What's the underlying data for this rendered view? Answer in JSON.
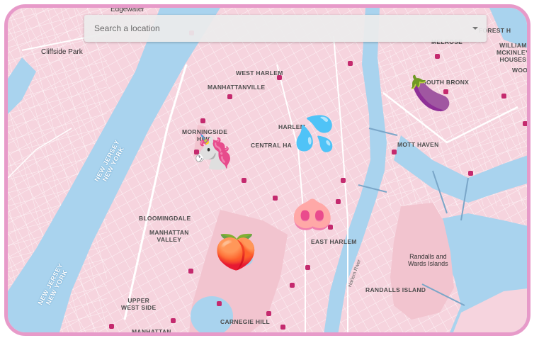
{
  "search": {
    "placeholder": "Search a location"
  },
  "colors": {
    "water": "#a9d3ee",
    "land": "#f6d4de",
    "park": "#f2c4cf",
    "frame": "#e79ac9",
    "poi": "#c42a6e"
  },
  "places": {
    "edgewater": "Edgewater",
    "forest_hills": "FOREST H",
    "cliffside_park": "Cliffside Park",
    "melrose": "MELROSE",
    "williams_mckinley": "WILLIAM\nMCKINLEY\nHOUSES",
    "woodst": "WOODST",
    "west_harlem": "WEST HARLEM",
    "manhattanville": "MANHATTANVILLE",
    "south_bronx": "SOUTH BRONX",
    "harlem": "HARLEM",
    "morningside": "MORNINGSIDE\nHEIG",
    "central_harlem": "CENTRAL HA",
    "mott_haven": "MOTT HAVEN",
    "new_jersey_top": "NEW JERSEY\nNEW YORK",
    "bloomingdale": "BLOOMINGDALE",
    "manhattan_valley": "MANHATTAN\nVALLEY",
    "east_harlem": "EAST HARLEM",
    "randalls_wards": "Randalls and\nWards Islands",
    "randalls_island": "RANDALLS ISLAND",
    "new_jersey_bottom": "NEW JERSEY\nNEW YORK",
    "upper_west_side": "UPPER\nWEST SIDE",
    "carnegie_hill": "CARNEGIE HILL",
    "manhattan": "MANHATTAN",
    "harlem_river": "Harlem River"
  },
  "markers": [
    {
      "name": "unicorn-marker",
      "glyph": "🦄"
    },
    {
      "name": "sweat-droplets-marker",
      "glyph": "💦"
    },
    {
      "name": "eggplant-marker",
      "glyph": "🍆"
    },
    {
      "name": "pig-nose-marker",
      "glyph": "🐽"
    },
    {
      "name": "peach-marker",
      "glyph": "🍑"
    }
  ]
}
